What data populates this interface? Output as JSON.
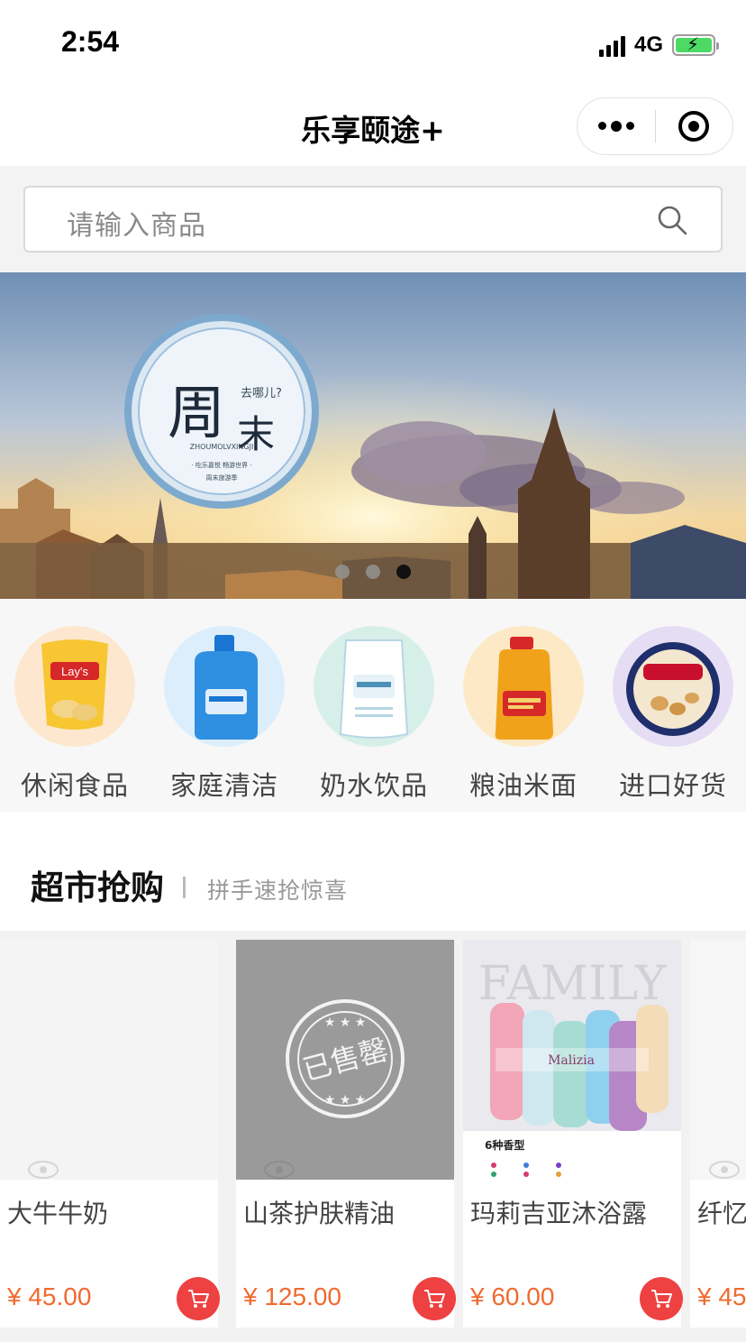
{
  "status_bar": {
    "time": "2:54",
    "network": "4G"
  },
  "nav": {
    "title": "乐享颐途+"
  },
  "search": {
    "placeholder": "请输入商品",
    "icon": "search-icon"
  },
  "banner": {
    "badge_title_left": "周",
    "badge_title_right": "末",
    "badge_question": "去哪儿?",
    "badge_pinyin": "ZHOUMOLVXINGJI",
    "badge_line1": "· 吃乐嘉悦 畅游世界 ·",
    "badge_line2": "周末旅游季",
    "slide_count": 3,
    "active_slide": 3
  },
  "categories": [
    {
      "label": "休闲食品",
      "icon": "snack-chips-icon",
      "color": "#f7b733"
    },
    {
      "label": "家庭清洁",
      "icon": "detergent-bottle-icon",
      "color": "#2f8fe0"
    },
    {
      "label": "奶水饮品",
      "icon": "milk-pack-icon",
      "color": "#bfe3de"
    },
    {
      "label": "粮油米面",
      "icon": "oil-bottle-icon",
      "color": "#f0a21b"
    },
    {
      "label": "进口好货",
      "icon": "cookie-tin-icon",
      "color": "#b9a9dd"
    }
  ],
  "section": {
    "title": "超市抢购",
    "subtitle": "拼手速抢惊喜"
  },
  "products": [
    {
      "name": "大牛牛奶",
      "price": "¥ 45.00",
      "sold_out": false,
      "sold_out_label": ""
    },
    {
      "name": "山茶护肤精油",
      "price": "¥ 125.00",
      "sold_out": true,
      "sold_out_label": "已售罄"
    },
    {
      "name": "玛莉吉亚沐浴露",
      "price": "¥ 60.00",
      "sold_out": false,
      "sold_out_label": "",
      "img_text_family": "FAMILY",
      "img_text_scent": "6种香型",
      "img_brand": "Malizia"
    },
    {
      "name": "纤忆",
      "price": "¥ 45",
      "sold_out": false,
      "sold_out_label": ""
    }
  ],
  "colors": {
    "price": "#f06a2f",
    "cart": "#ee4141",
    "background": "#f3f3f3"
  }
}
